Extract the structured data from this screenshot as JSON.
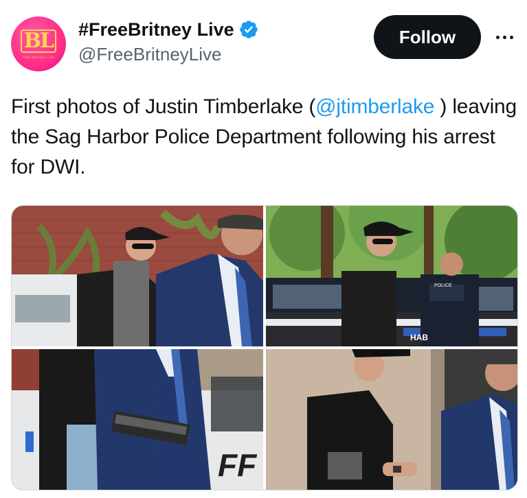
{
  "account": {
    "display_name": "#FreeBritney Live",
    "handle": "@FreeBritneyLive",
    "avatar_text": "BL",
    "avatar_subtext": "FREE BRITNEY LIVE",
    "verified": true,
    "verified_color": "#1d9bf0"
  },
  "actions": {
    "follow_label": "Follow",
    "more_icon": "more-horizontal-icon"
  },
  "tweet": {
    "text_before": "First photos of Justin Timberlake (",
    "mention": "@jtimberlake",
    "text_after": " ) leaving the Sag Harbor Police Department following his arrest for DWI."
  },
  "media": {
    "photo_count": 4,
    "photos": [
      {
        "description_name": "photo-1"
      },
      {
        "description_name": "photo-2",
        "car_text": "POLICE",
        "car_side_text": "HAB"
      },
      {
        "description_name": "photo-3",
        "car_side_text": "FF"
      },
      {
        "description_name": "photo-4"
      }
    ]
  },
  "colors": {
    "text_primary": "#0f1419",
    "text_secondary": "#536471",
    "link": "#1d9bf0",
    "follow_bg": "#0f1419",
    "avatar_bg": "#ff2e8a"
  }
}
